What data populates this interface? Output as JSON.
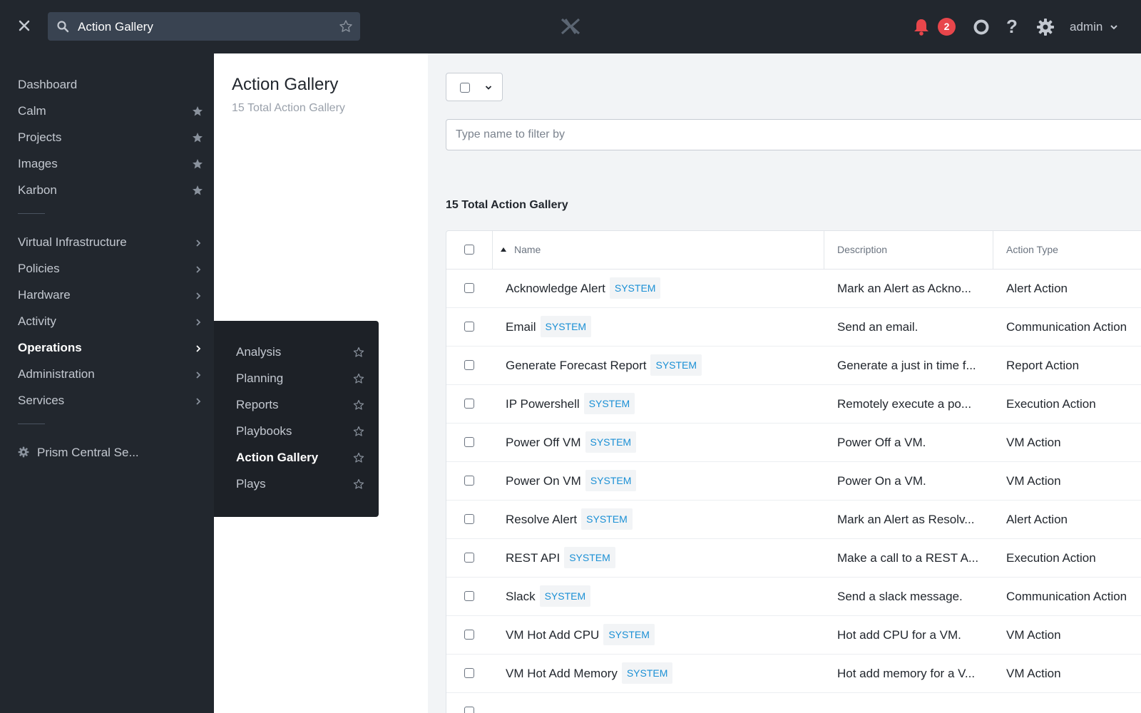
{
  "topbar": {
    "search_value": "Action Gallery",
    "notification_count": "2",
    "help_glyph": "?",
    "user": "admin"
  },
  "sidebar": {
    "items": [
      {
        "label": "Dashboard"
      },
      {
        "label": "Calm"
      },
      {
        "label": "Projects"
      },
      {
        "label": "Images"
      },
      {
        "label": "Karbon"
      },
      {
        "label": "Virtual Infrastructure"
      },
      {
        "label": "Policies"
      },
      {
        "label": "Hardware"
      },
      {
        "label": "Activity"
      },
      {
        "label": "Operations"
      },
      {
        "label": "Administration"
      },
      {
        "label": "Services"
      }
    ],
    "settings_label": "Prism Central Se..."
  },
  "flyout": {
    "items": [
      {
        "label": "Analysis"
      },
      {
        "label": "Planning"
      },
      {
        "label": "Reports"
      },
      {
        "label": "Playbooks"
      },
      {
        "label": "Action Gallery"
      },
      {
        "label": "Plays"
      }
    ]
  },
  "panel": {
    "title": "Action Gallery",
    "subtitle": "15 Total Action Gallery"
  },
  "main": {
    "filter_placeholder": "Type name to filter by",
    "count_label": "15 Total Action Gallery",
    "columns": {
      "name": "Name",
      "description": "Description",
      "type": "Action Type"
    },
    "tag": "SYSTEM",
    "rows": [
      {
        "name": "Acknowledge Alert",
        "description": "Mark an Alert as Ackno...",
        "type": "Alert Action"
      },
      {
        "name": "Email",
        "description": "Send an email.",
        "type": "Communication Action"
      },
      {
        "name": "Generate Forecast Report",
        "description": "Generate a just in time f...",
        "type": "Report Action"
      },
      {
        "name": "IP Powershell",
        "description": "Remotely execute a po...",
        "type": "Execution Action"
      },
      {
        "name": "Power Off VM",
        "description": "Power Off a VM.",
        "type": "VM Action"
      },
      {
        "name": "Power On VM",
        "description": "Power On a VM.",
        "type": "VM Action"
      },
      {
        "name": "Resolve Alert",
        "description": "Mark an Alert as Resolv...",
        "type": "Alert Action"
      },
      {
        "name": "REST API",
        "description": "Make a call to a REST A...",
        "type": "Execution Action"
      },
      {
        "name": "Slack",
        "description": "Send a slack message.",
        "type": "Communication Action"
      },
      {
        "name": "VM Hot Add CPU",
        "description": "Hot add CPU for a VM.",
        "type": "VM Action"
      },
      {
        "name": "VM Hot Add Memory",
        "description": "Hot add memory for a V...",
        "type": "VM Action"
      }
    ]
  },
  "colors": {
    "nav_bg": "#22272e",
    "flyout_bg": "#1d2127",
    "tag_text": "#1b90d5",
    "badge_bg": "#e8464b",
    "bell": "#e8464b"
  },
  "icons": [
    "close-icon",
    "search-icon",
    "star-outline-icon",
    "nutanix-logo-icon",
    "bell-icon",
    "circle-icon",
    "help-icon",
    "gear-icon",
    "chevron-down-icon",
    "chevron-right-icon",
    "star-filled-icon",
    "sort-up-icon"
  ]
}
